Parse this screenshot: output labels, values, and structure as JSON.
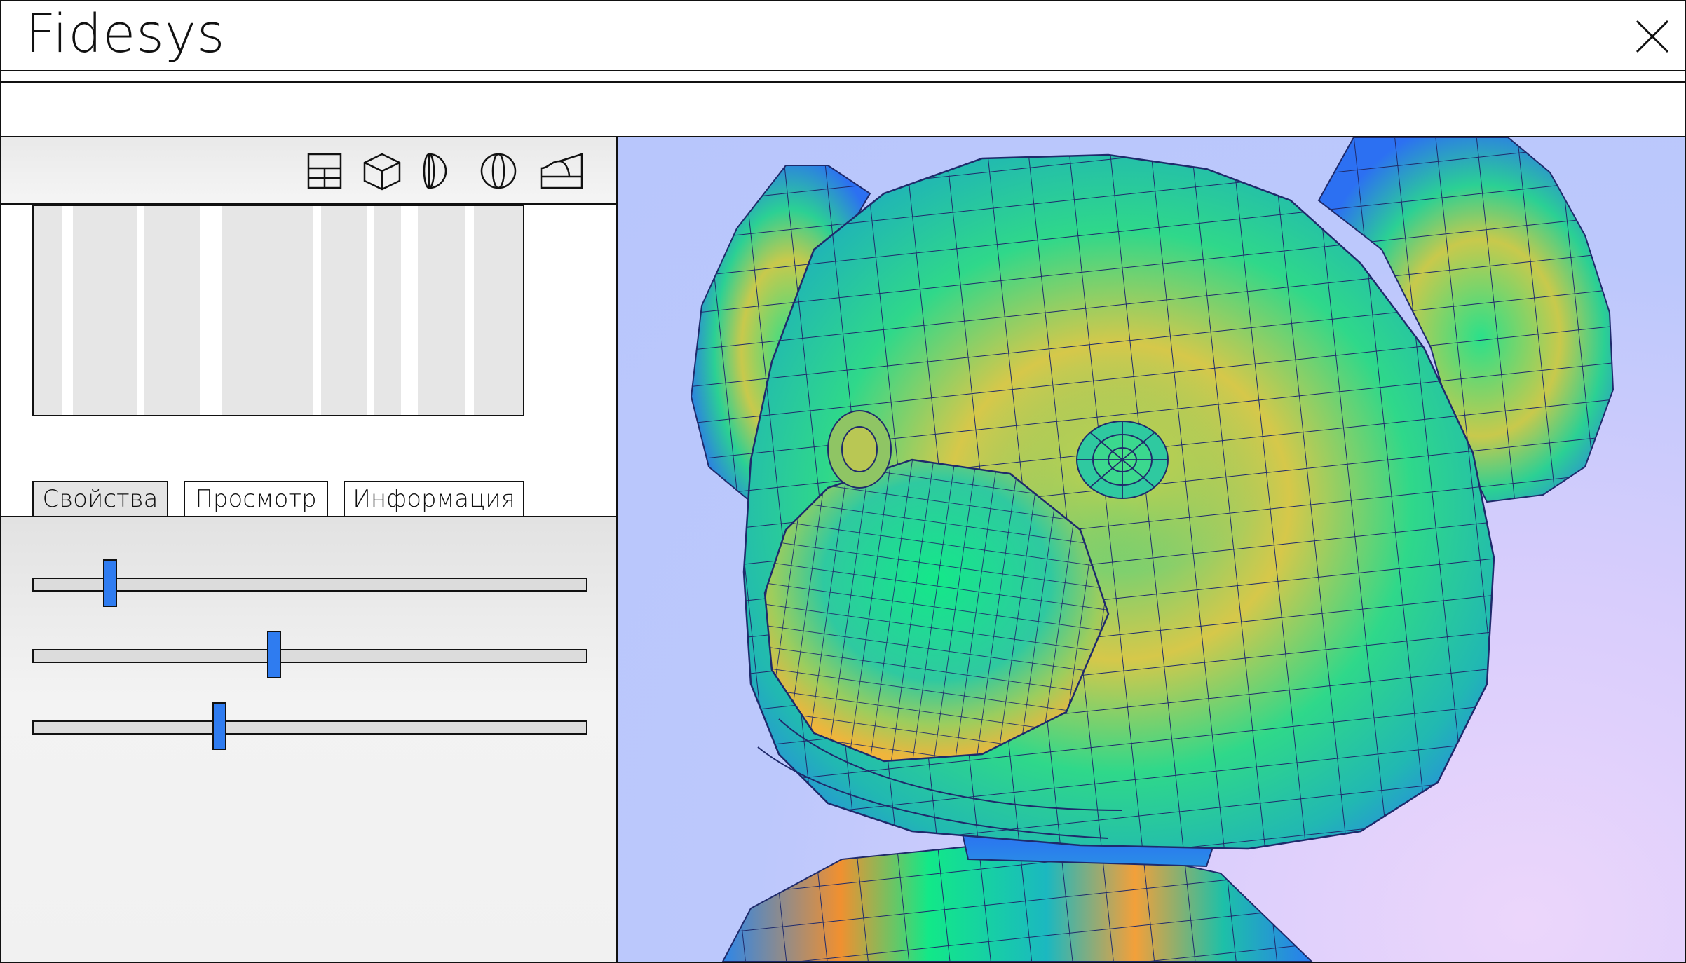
{
  "window": {
    "title": "Fidesys",
    "close_icon": "close-icon"
  },
  "colors": {
    "accent": "#2f7cf0",
    "viewport_bg": "#b8c6fc",
    "active_tab_bg": "#e4e4e4"
  },
  "left_panel": {
    "toolbar_icons": [
      "layout-grid-icon",
      "cube-icon",
      "half-sphere-icon",
      "sphere-icon",
      "extrude-profile-icon"
    ],
    "tabs": [
      {
        "label": "Свойства",
        "active": true
      },
      {
        "label": "Просмотр",
        "active": false
      },
      {
        "label": "Информация",
        "active": false
      }
    ],
    "sliders": [
      {
        "name": "slider-1",
        "value": 0.14
      },
      {
        "name": "slider-2",
        "value": 0.435
      },
      {
        "name": "slider-3",
        "value": 0.337
      }
    ]
  },
  "viewport": {
    "model": "teddy-bear-mesh",
    "colormap": "blue-green-yellow-orange"
  }
}
